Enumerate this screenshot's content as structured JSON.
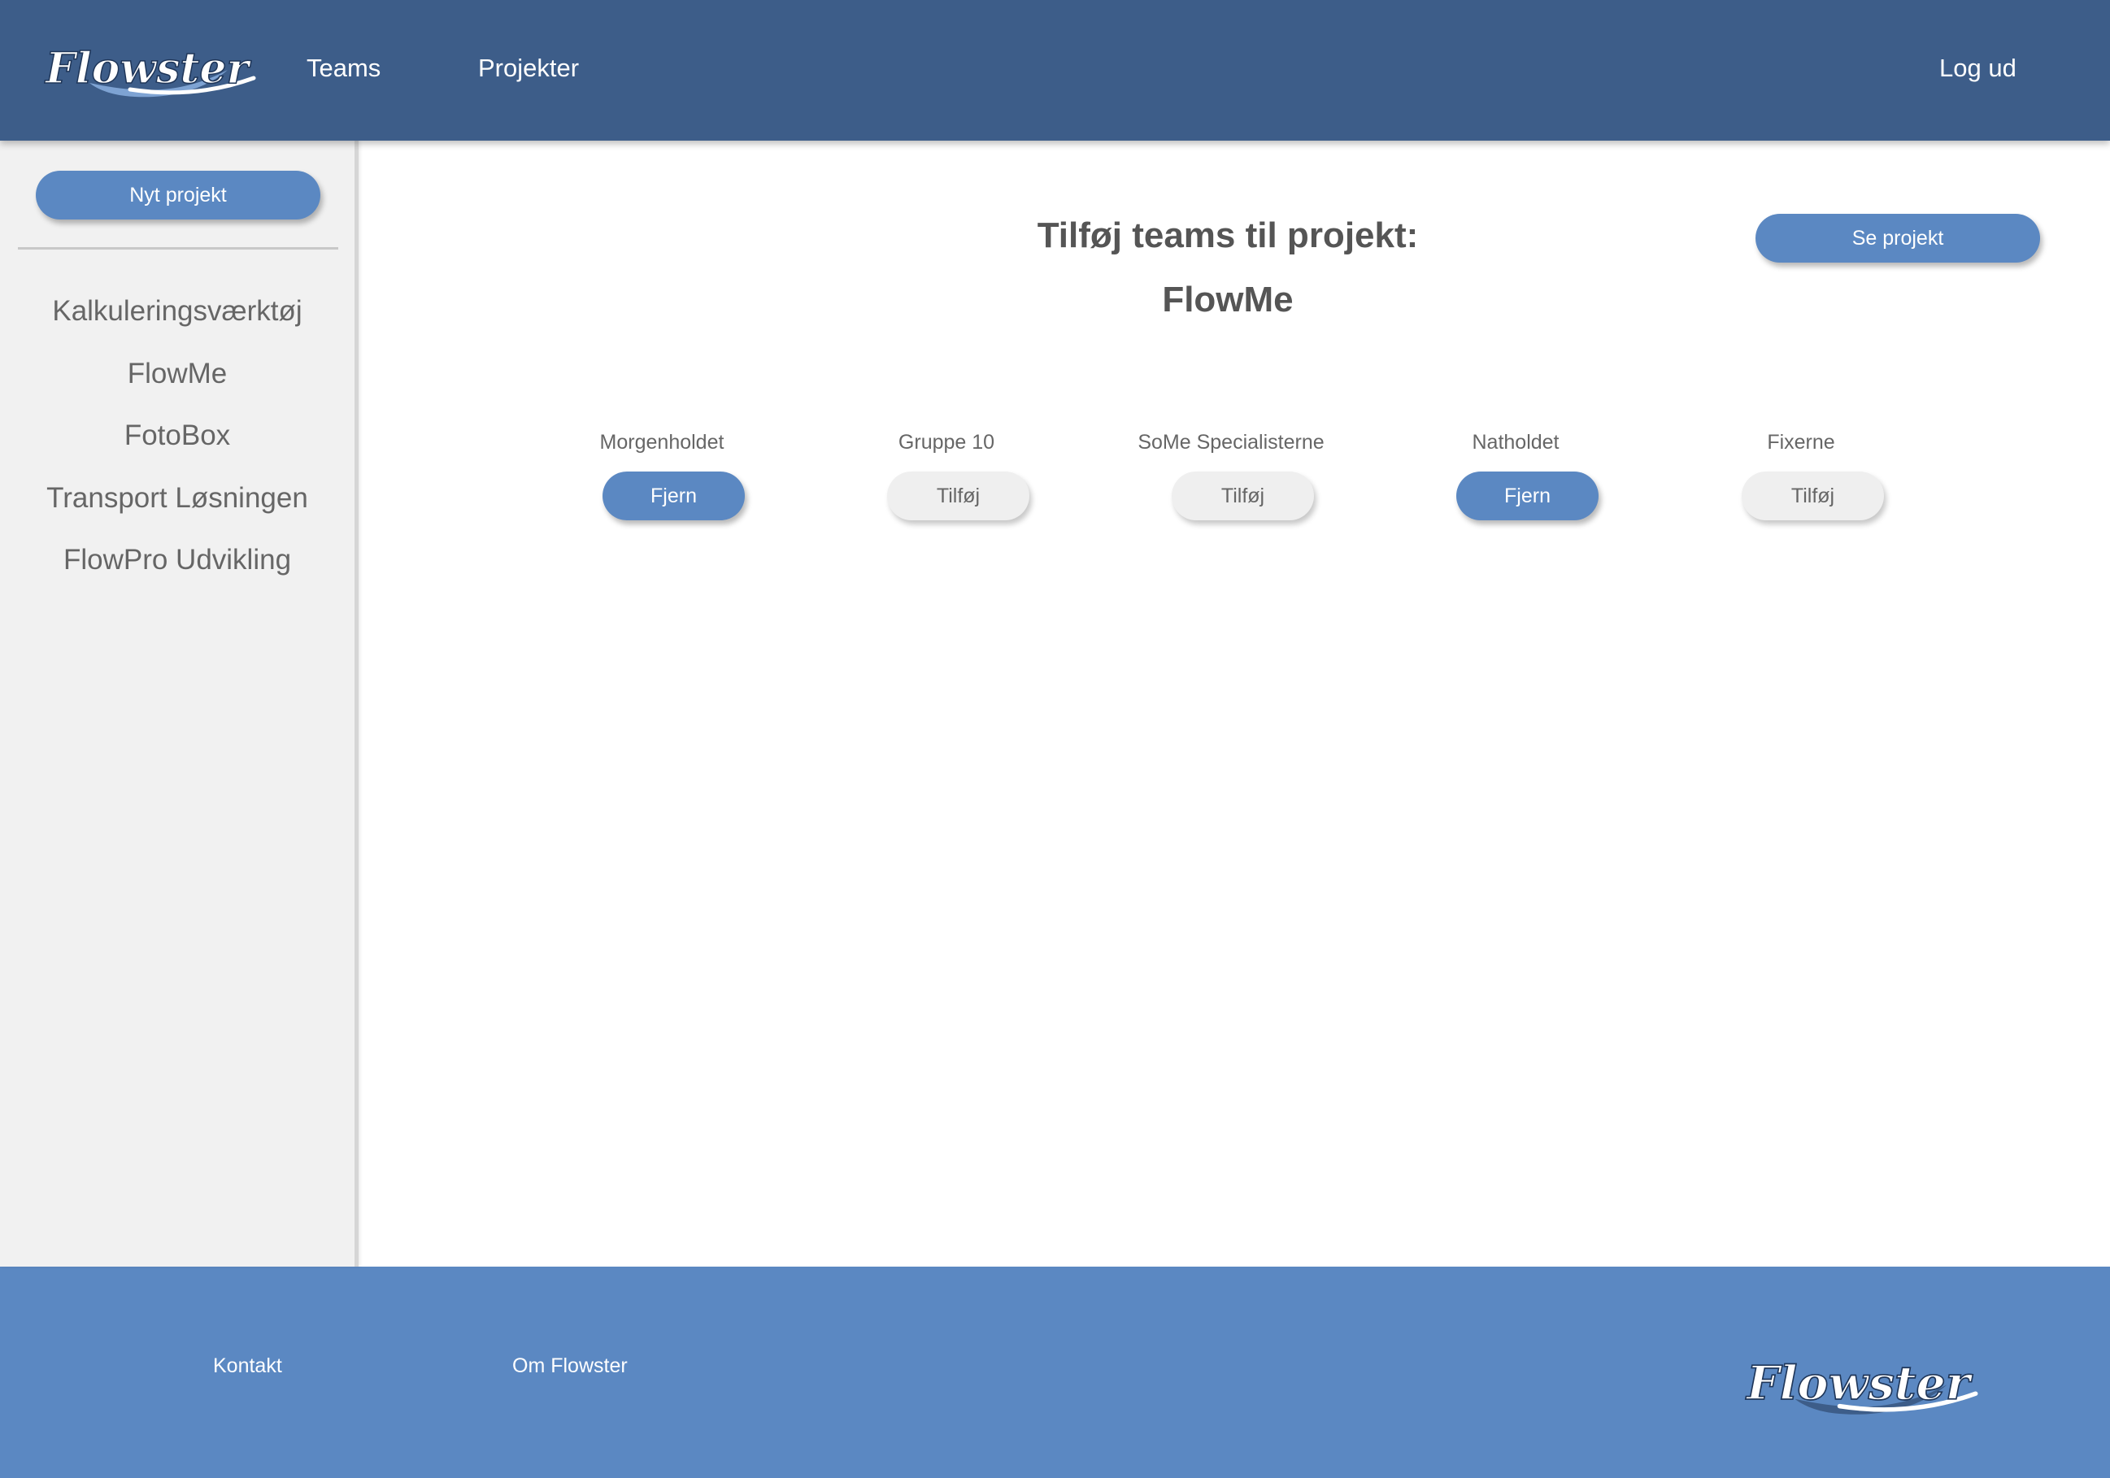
{
  "header": {
    "logo_text": "Flowster",
    "nav": {
      "teams": "Teams",
      "projects": "Projekter"
    },
    "logout": "Log ud"
  },
  "sidebar": {
    "new_project": "Nyt projekt",
    "projects": [
      "Kalkuleringsværktøj",
      "FlowMe",
      "FotoBox",
      "Transport Løsningen",
      "FlowPro Udvikling"
    ]
  },
  "main": {
    "title": "Tilføj teams til projekt:",
    "project_name": "FlowMe",
    "see_project": "Se projekt",
    "teams": [
      {
        "name": "Morgenholdet",
        "action": "Fjern",
        "added": true
      },
      {
        "name": "Gruppe 10",
        "action": "Tilføj",
        "added": false
      },
      {
        "name": "SoMe Specialisterne",
        "action": "Tilføj",
        "added": false
      },
      {
        "name": "Natholdet",
        "action": "Fjern",
        "added": true
      },
      {
        "name": "Fixerne",
        "action": "Tilføj",
        "added": false
      }
    ]
  },
  "footer": {
    "contact": "Kontakt",
    "about": "Om Flowster",
    "logo_text": "Flowster"
  },
  "colors": {
    "header_bg": "#3d5d89",
    "accent": "#5b88c2",
    "sidebar_bg": "#f1f1f1",
    "neutral_button": "#efefef"
  }
}
